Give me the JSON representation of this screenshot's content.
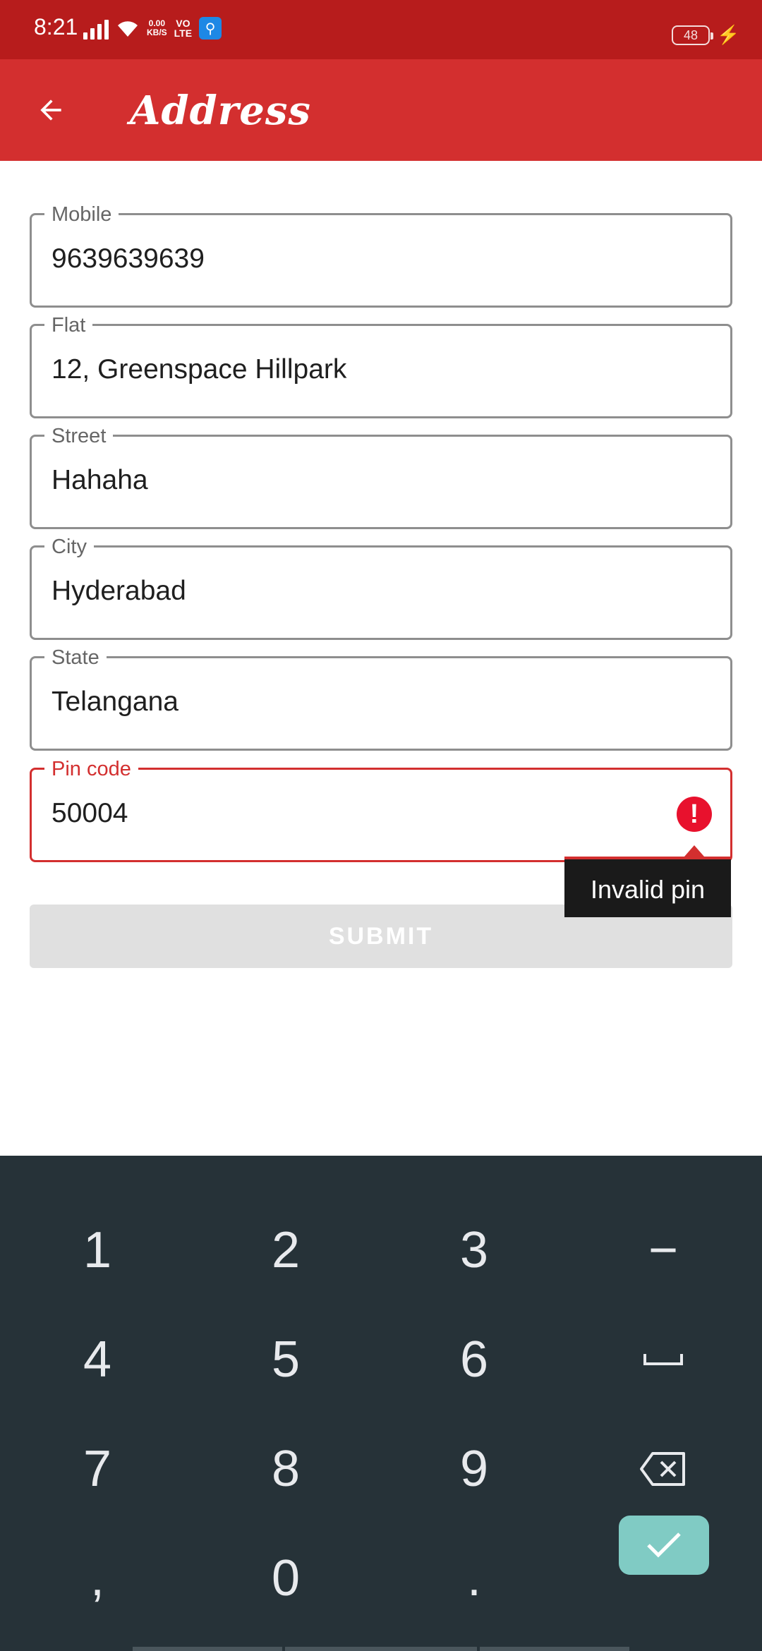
{
  "status_bar": {
    "time": "8:21",
    "net_speed_value": "0.00",
    "net_speed_unit": "KB/S",
    "volte_top": "VO",
    "volte_bottom": "LTE",
    "battery": "48"
  },
  "app_bar": {
    "title": "Address"
  },
  "form": {
    "fields": [
      {
        "label": "Mobile",
        "value": "9639639639"
      },
      {
        "label": "Flat",
        "value": "12, Greenspace Hillpark"
      },
      {
        "label": "Street",
        "value": "Hahaha"
      },
      {
        "label": "City",
        "value": "Hyderabad"
      },
      {
        "label": "State",
        "value": "Telangana"
      },
      {
        "label": "Pin code",
        "value": "50004"
      }
    ],
    "error_tooltip": "Invalid pin",
    "submit_label": "SUBMIT"
  },
  "keyboard": {
    "keys": [
      "1",
      "2",
      "3",
      "−",
      "4",
      "5",
      "6",
      "␣",
      "7",
      "8",
      "9",
      "⌫",
      ",",
      "0",
      "."
    ],
    "done_icon": "check-icon"
  },
  "colors": {
    "status_bar": "#b71c1c",
    "app_bar": "#d32f2f",
    "error": "#d32f2f",
    "keyboard_bg": "#263238",
    "done_key": "#80cbc4"
  }
}
